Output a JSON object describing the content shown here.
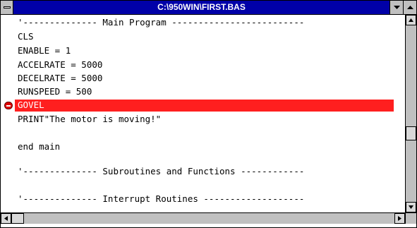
{
  "window": {
    "title": "C:\\950WIN\\FIRST.BAS"
  },
  "icons": {
    "system_menu": "system-menu-icon",
    "minimize": "triangle-down",
    "maximize": "triangle-up",
    "breakpoint": "stop-sign",
    "scroll_up": "triangle-up",
    "scroll_down": "triangle-down",
    "scroll_left": "triangle-left",
    "scroll_right": "triangle-right"
  },
  "colors": {
    "titlebar": "#0000a8",
    "highlight": "#ff1f1f",
    "breakpoint": "#e00000"
  },
  "editor": {
    "lines": [
      "'-------------- Main Program -------------------------",
      "CLS",
      "ENABLE = 1",
      "ACCELRATE = 5000",
      "DECELRATE = 5000",
      "RUNSPEED = 500",
      "GOVEL",
      "PRINT\"The motor is moving!\"",
      "",
      "end main",
      "",
      "'-------------- Subroutines and Functions ------------",
      "",
      "'-------------- Interrupt Routines -------------------"
    ],
    "highlighted_line": "GOVEL"
  }
}
